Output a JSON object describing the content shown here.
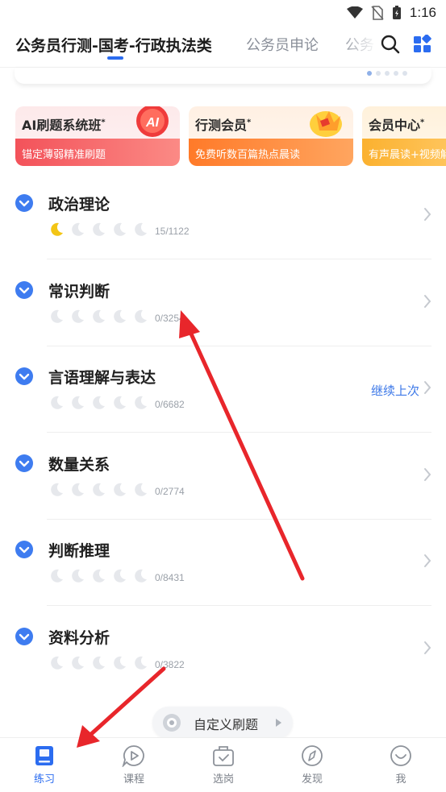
{
  "status_bar": {
    "time": "1:16"
  },
  "tabs": [
    {
      "label": "公务员行测-国考-行政执法类",
      "active": true
    },
    {
      "label": "公务员申论",
      "active": false
    },
    {
      "label": "公务",
      "active": false
    }
  ],
  "promos": [
    {
      "title": "AI刷题系统班",
      "subtitle": "锚定薄弱精准刷题",
      "badge_text": "AI"
    },
    {
      "title": "行测会员",
      "subtitle": "免费听数百篇热点晨读"
    },
    {
      "title": "会员中心",
      "subtitle": "有声晨读+视频解"
    }
  ],
  "subjects": [
    {
      "title": "政治理论",
      "count": "15/1122",
      "progress_moons": 1,
      "show_continue": false
    },
    {
      "title": "常识判断",
      "count": "0/3254",
      "progress_moons": 0,
      "show_continue": false
    },
    {
      "title": "言语理解与表达",
      "count": "0/6682",
      "progress_moons": 0,
      "show_continue": true
    },
    {
      "title": "数量关系",
      "count": "0/2774",
      "progress_moons": 0,
      "show_continue": false
    },
    {
      "title": "判断推理",
      "count": "0/8431",
      "progress_moons": 0,
      "show_continue": false
    },
    {
      "title": "资料分析",
      "count": "0/3822",
      "progress_moons": 0,
      "show_continue": false
    }
  ],
  "continue_label": "继续上次",
  "custom_practice_label": "自定义刷题",
  "bottom_nav": [
    {
      "label": "练习",
      "icon": "book-icon",
      "active": true
    },
    {
      "label": "课程",
      "icon": "play-bubble-icon",
      "active": false
    },
    {
      "label": "选岗",
      "icon": "briefcase-check-icon",
      "active": false
    },
    {
      "label": "发现",
      "icon": "compass-icon",
      "active": false
    },
    {
      "label": "我",
      "icon": "smile-icon",
      "active": false
    }
  ],
  "colors": {
    "accent": "#2b6cf0",
    "check": "#3e7cf0",
    "moon_active": "#f3c515",
    "moon_inactive": "#e6e8ec",
    "annotation_arrow": "#e8262b"
  }
}
